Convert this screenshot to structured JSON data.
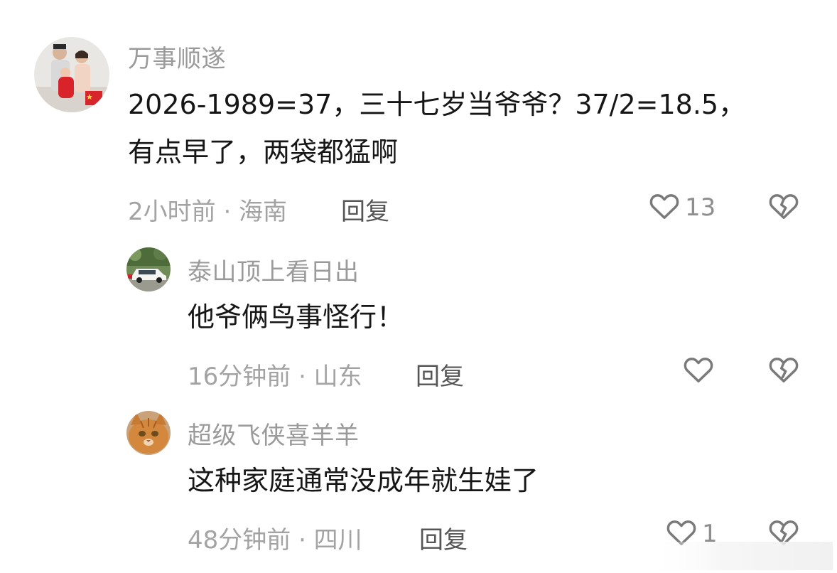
{
  "comments": [
    {
      "username": "万事顺遂",
      "content_lines": [
        "2026-1989=37，三十七岁当爷爷？37/2=18.5，",
        "有点早了，两袋都猛啊"
      ],
      "meta": "2小时前 · 海南",
      "reply_label": "回复",
      "like_count": "13",
      "avatar": "family-photo-avatar"
    },
    {
      "username": "泰山顶上看日出",
      "content_lines": [
        "他爷俩鸟事怪行！"
      ],
      "meta": "16分钟前 · 山东",
      "reply_label": "回复",
      "like_count": "",
      "avatar": "white-car-avatar"
    },
    {
      "username": "超级飞侠喜羊羊",
      "content_lines": [
        "这种家庭通常没成年就生娃了"
      ],
      "meta": "48分钟前 · 四川",
      "reply_label": "回复",
      "like_count": "1",
      "avatar": "orange-cat-avatar"
    }
  ],
  "icons": {
    "like": "heart-outline-icon",
    "dislike": "broken-heart-icon"
  },
  "colors": {
    "username": "#9a9a9a",
    "content": "#161616",
    "meta": "#a3a3a3",
    "reply": "#555555",
    "icon": "#7a7a7a"
  }
}
